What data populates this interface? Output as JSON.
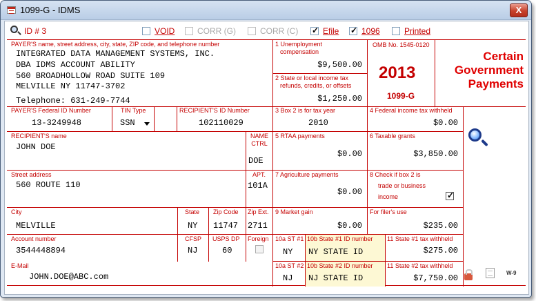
{
  "window": {
    "title": "1099-G - IDMS",
    "close_label": "X"
  },
  "toolbar": {
    "id_label": "ID # 3",
    "void": {
      "label": "VOID",
      "checked": false
    },
    "corr_g": {
      "label": "CORR (G)",
      "checked": false,
      "disabled": true
    },
    "corr_c": {
      "label": "CORR (C)",
      "checked": false,
      "disabled": true
    },
    "efile": {
      "label": "Efile",
      "checked": true
    },
    "f1096": {
      "label": "1096",
      "checked": true
    },
    "printed": {
      "label": "Printed",
      "checked": false
    }
  },
  "payer": {
    "label": "PAYER'S name, street address, city, state, ZIP code, and telephone number",
    "lines": [
      "INTEGRATED DATA MANAGEMENT SYSTEMS, INC.",
      "DBA IDMS ACCOUNT ABILITY",
      "560 BROADHOLLOW ROAD SUITE 109",
      "MELVILLE NY 11747-3702"
    ],
    "telephone": "Telephone: 631-249-7744",
    "federal_id_label": "PAYER'S Federal ID Number",
    "federal_id": "13-3249948",
    "tin_type_label": "TIN Type",
    "tin_type": "SSN"
  },
  "boxes": {
    "b1_label_1": "1 Unemployment",
    "b1_label_2": "compensation",
    "b1_value": "$9,500.00",
    "b2_label_1": "2 State or local income tax",
    "b2_label_2": "refunds, credits, or offsets",
    "b2_value": "$1,250.00",
    "omb": "OMB No. 1545-0120",
    "year": "2013",
    "form_name": "1099-G",
    "b3_label": "3 Box 2 is for tax year",
    "b3_value": "2010",
    "b4_label": "4 Federal income tax withheld",
    "b4_value": "$0.00",
    "b5_label": "5 RTAA payments",
    "b5_value": "$0.00",
    "b6_label": "6 Taxable grants",
    "b6_value": "$3,850.00",
    "b7_label": "7 Agriculture payments",
    "b7_value": "$0.00",
    "b8_label_1": "8 Check if box 2 is",
    "b8_label_2": "trade or business",
    "b8_label_3": "income",
    "b8_checked": true,
    "b9_label": "9 Market gain",
    "b9_value": "$0.00",
    "filer_label": "For filer's use",
    "filer_value": "$235.00",
    "b10a1_label": "10a ST #1",
    "b10a1_value": "NY",
    "b10b1_label": "10b State #1 ID number",
    "b10b1_value": "NY STATE ID",
    "b11_1_label": "11 State #1 tax withheld",
    "b11_1_value": "$275.00",
    "b10a2_label": "10a ST #2",
    "b10a2_value": "NJ",
    "b10b2_label": "10b State #2 ID number",
    "b10b2_value": "NJ STATE ID",
    "b11_2_label": "11 State #2 tax withheld",
    "b11_2_value": "$7,750.00"
  },
  "heading": {
    "line1": "Certain",
    "line2": "Government",
    "line3": "Payments"
  },
  "recipient": {
    "id_label": "RECIPIENT'S ID Number",
    "id": "102110029",
    "name_label": "RECIPIENT'S name",
    "name": "JOHN DOE",
    "name_ctrl_label_1": "NAME",
    "name_ctrl_label_2": "CTRL",
    "name_ctrl": "DOE",
    "street_label": "Street address",
    "street": "560 ROUTE 110",
    "apt_label": "APT.",
    "apt": "101A",
    "city_label": "City",
    "city": "MELVILLE",
    "state_label": "State",
    "state": "NY",
    "zip_label": "Zip Code",
    "zip": "11747",
    "zip_ext_label": "Zip Ext.",
    "zip_ext": "2711",
    "account_label": "Account number",
    "account": "3544448894",
    "cfsp_label": "CFSP",
    "cfsp": "NJ",
    "usps_label": "USPS DP",
    "usps": "60",
    "foreign_label": "Foreign",
    "foreign_checked": false,
    "email_label": "E-Mail",
    "email": "JOHN.DOE@ABC.com"
  },
  "icons": [
    "magnifier-icon",
    "search-icon",
    "lock-icon",
    "document-icon",
    "w9-icon"
  ]
}
